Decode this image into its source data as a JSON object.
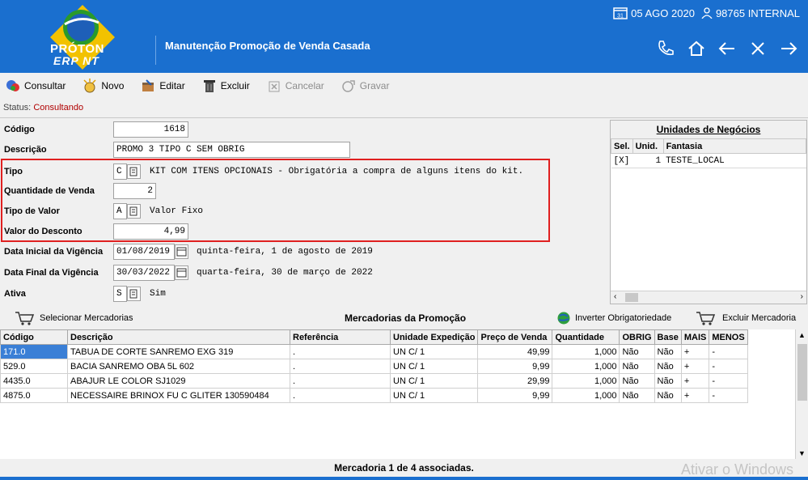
{
  "header": {
    "logo_line1": "PRÓTON",
    "logo_line2": "ERP NT",
    "title": "Manutenção Promoção de Venda Casada",
    "date": "05 AGO 2020",
    "calendar_day": "31",
    "user": "98765 INTERNAL",
    "icons": [
      "phone-icon",
      "home-icon",
      "back-arrow-icon",
      "close-icon",
      "forward-arrow-icon"
    ]
  },
  "toolbar": {
    "consultar": "Consultar",
    "novo": "Novo",
    "editar": "Editar",
    "excluir": "Excluir",
    "cancelar": "Cancelar",
    "gravar": "Gravar"
  },
  "status": {
    "label": "Status:",
    "value": "Consultando"
  },
  "form": {
    "codigo_label": "Código",
    "codigo": "1618",
    "descricao_label": "Descrição",
    "descricao": "PROMO 3 TIPO C SEM OBRIG",
    "tipo_label": "Tipo",
    "tipo": "C",
    "tipo_desc": "KIT COM ITENS OPCIONAIS - Obrigatória a compra de alguns itens do kit.",
    "qtd_label": "Quantidade de Venda",
    "qtd": "2",
    "tipo_valor_label": "Tipo de Valor",
    "tipo_valor": "A",
    "tipo_valor_desc": "Valor Fixo",
    "valor_desc_label": "Valor do Desconto",
    "valor_desc": "4,99",
    "data_ini_label": "Data Inicial da Vigência",
    "data_ini": "01/08/2019",
    "data_ini_desc": "quinta-feira, 1 de agosto de 2019",
    "data_fim_label": "Data Final da Vigência",
    "data_fim": "30/03/2022",
    "data_fim_desc": "quarta-feira, 30 de março de 2022",
    "ativa_label": "Ativa",
    "ativa": "S",
    "ativa_desc": "Sim"
  },
  "unidades": {
    "title": "Unidades de Negócios",
    "headers": [
      "Sel.",
      "Unid.",
      "Fantasia"
    ],
    "rows": [
      [
        "[X]",
        "1",
        "TESTE_LOCAL"
      ]
    ]
  },
  "mercadorias": {
    "selecionar": "Selecionar Mercadorias",
    "title": "Mercadorias da Promoção",
    "inverter": "Inverter Obrigatoriedade",
    "excluir": "Excluir Mercadoria",
    "headers": [
      "Código",
      "Descrição",
      "Referência",
      "Unidade Expedição",
      "Preço de Venda",
      "Quantidade",
      "OBRIG",
      "Base",
      "MAIS",
      "MENOS"
    ],
    "rows": [
      [
        "171.0",
        "TABUA DE CORTE SANREMO EXG 319",
        ".",
        "UN C/ 1",
        "49,99",
        "1,000",
        "Não",
        "Não",
        "+",
        "-"
      ],
      [
        "529.0",
        "BACIA SANREMO OBA 5L 602",
        ".",
        "UN C/ 1",
        "9,99",
        "1,000",
        "Não",
        "Não",
        "+",
        "-"
      ],
      [
        "4435.0",
        "ABAJUR LE COLOR SJ1029",
        ".",
        "UN C/ 1",
        "29,99",
        "1,000",
        "Não",
        "Não",
        "+",
        "-"
      ],
      [
        "4875.0",
        "NECESSAIRE BRINOX FU C GLITER 130590484",
        ".",
        "UN C/ 1",
        "9,99",
        "1,000",
        "Não",
        "Não",
        "+",
        "-"
      ]
    ]
  },
  "footer": {
    "text": "Mercadoria 1 de 4 associadas."
  },
  "watermark": "Ativar o Windows",
  "colors": {
    "header_bg": "#1a6fcf",
    "highlight_border": "#e02020",
    "selected_cell": "#3a7fd6",
    "status_value": "#b00000"
  }
}
